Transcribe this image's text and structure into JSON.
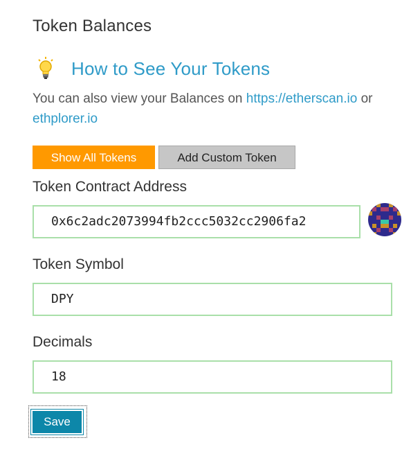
{
  "header": {
    "title": "Token Balances"
  },
  "howto": {
    "title": "How to See Your Tokens",
    "icon": "lightbulb-icon"
  },
  "info": {
    "text_before": "You can also view your Balances on ",
    "link1": "https://etherscan.io",
    "text_between": " or ",
    "link2": "ethplorer.io"
  },
  "buttons": {
    "show_all": "Show All Tokens",
    "add_custom": "Add Custom Token",
    "save": "Save"
  },
  "fields": {
    "address": {
      "label": "Token Contract Address",
      "value": "0x6c2adc2073994fb2ccc5032cc2906fa2"
    },
    "symbol": {
      "label": "Token Symbol",
      "value": "DPY"
    },
    "decimals": {
      "label": "Decimals",
      "value": "18"
    }
  },
  "colors": {
    "accent": "#ff9900",
    "link": "#2f9bc8",
    "valid_border": "#a9dfa9",
    "primary_button": "#0d87a9"
  }
}
